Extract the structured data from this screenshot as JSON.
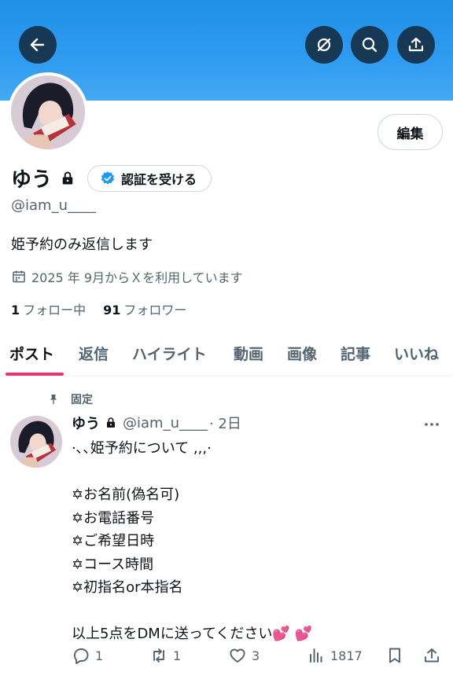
{
  "profile": {
    "display_name": "ゆう",
    "handle": "@iam_u____",
    "bio": "姫予約のみ返信します",
    "joined": "2025 年 9月からＸを利用しています",
    "following_count": "1",
    "following_label": "フォロー中",
    "followers_count": "91",
    "followers_label": "フォロワー",
    "edit_label": "編集",
    "verify_label": "認証を受ける"
  },
  "colors": {
    "banner": "#1f90e6",
    "accent": "#e8336f",
    "verified": "#1d9bf0"
  },
  "tabs": [
    {
      "label": "ポスト"
    },
    {
      "label": "返信"
    },
    {
      "label": "ハイライト"
    },
    {
      "label": "動画"
    },
    {
      "label": "画像"
    },
    {
      "label": "記事"
    },
    {
      "label": "いいね"
    }
  ],
  "post": {
    "pinned_label": "固定",
    "author": "ゆう",
    "handle": "@iam_u____",
    "time": "· 2日",
    "lines": [
      "·､､姫予約について ,,,·",
      "",
      "✡お名前(偽名可)",
      "✡お電話番号",
      "✡ご希望日時",
      "✡コース時間",
      "✡初指名or本指名",
      "",
      "以上5点をDMに送ってください💕 💕"
    ],
    "replies": "1",
    "reposts": "1",
    "likes": "3",
    "views": "1817"
  }
}
